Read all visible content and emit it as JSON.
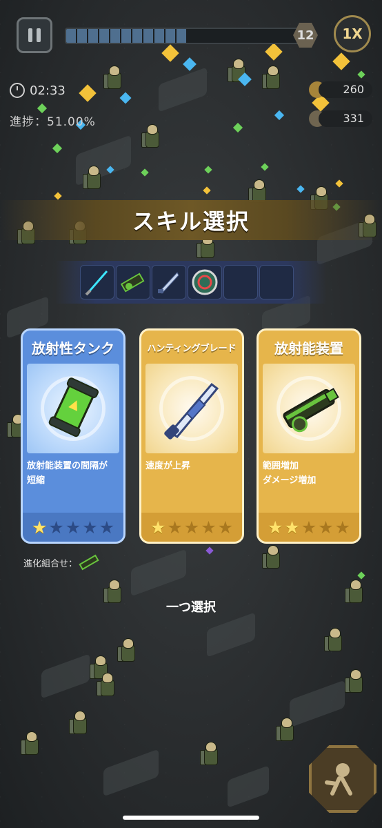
{
  "hud": {
    "level": "12",
    "speed": "1X",
    "timer": "02:33",
    "progress_text": "進捗：51.00%",
    "progress": 0.51,
    "coins": "260",
    "kills": "331"
  },
  "title": "スキル選択",
  "owned_skills": [
    {
      "name": "laser-sword-icon"
    },
    {
      "name": "gatling-gun-icon"
    },
    {
      "name": "hunting-blade-icon"
    },
    {
      "name": "shield-disc-icon"
    },
    {
      "name": "empty-slot"
    },
    {
      "name": "empty-slot"
    }
  ],
  "cards": [
    {
      "title": "放射性タンク",
      "desc_lines": [
        "放射能装置の間隔が",
        "短縮"
      ],
      "stars": 1,
      "max_stars": 5,
      "color": "#5b8edc"
    },
    {
      "title": "ハンティングブレード",
      "desc_lines": [
        "速度が上昇"
      ],
      "stars": 1,
      "max_stars": 5,
      "color": "#e6b54b"
    },
    {
      "title": "放射能装置",
      "desc_lines": [
        "範囲増加",
        "ダメージ増加"
      ],
      "stars": 2,
      "max_stars": 5,
      "color": "#e6b54b"
    }
  ],
  "evolve_label": "進化組合せ：",
  "choose_label": "一つ選択"
}
